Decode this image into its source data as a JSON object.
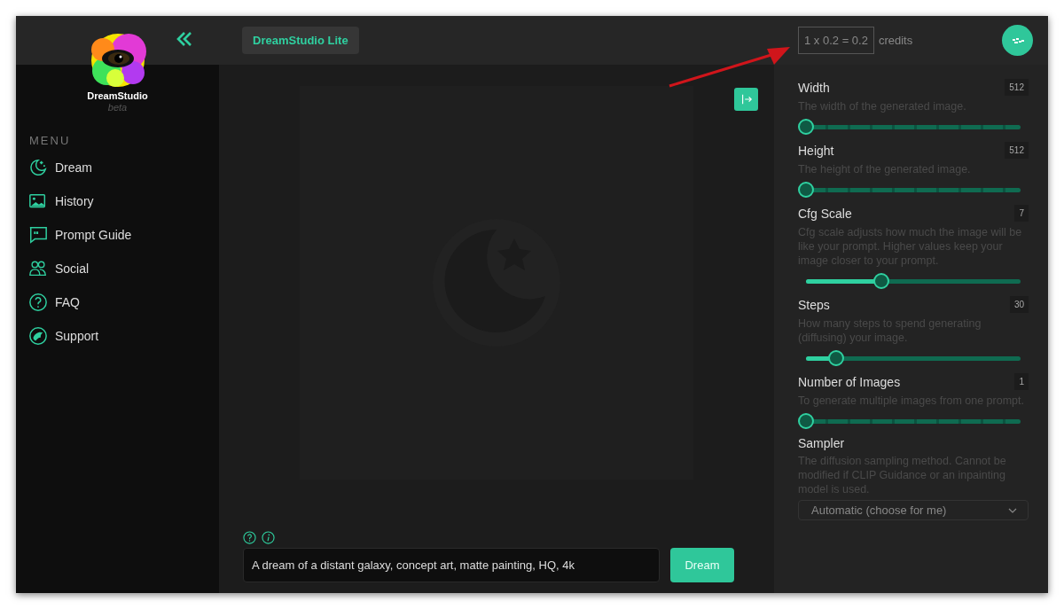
{
  "sidebar": {
    "brand": "DreamStudio",
    "brand_tag": "beta",
    "menu_heading": "MENU",
    "items": [
      {
        "label": "Dream"
      },
      {
        "label": "History"
      },
      {
        "label": "Prompt Guide"
      },
      {
        "label": "Social"
      },
      {
        "label": "FAQ"
      },
      {
        "label": "Support"
      }
    ]
  },
  "header": {
    "product": "DreamStudio Lite"
  },
  "credits": {
    "formula": "1 x 0.2 = 0.2",
    "unit": "credits"
  },
  "settings": [
    {
      "kind": "stepped",
      "label": "Width",
      "value": "512",
      "description": "The width of the generated image.",
      "level": 0
    },
    {
      "kind": "stepped",
      "label": "Height",
      "value": "512",
      "description": "The height of the generated image.",
      "level": 0
    },
    {
      "kind": "fine",
      "label": "Cfg Scale",
      "value": "7",
      "description": "Cfg scale adjusts how much the image will be like your prompt. Higher values keep your image closer to your prompt.",
      "level": 0.35
    },
    {
      "kind": "smooth",
      "label": "Steps",
      "value": "30",
      "description": "How many steps to spend generating (diffusing) your image.",
      "level": 0.14
    },
    {
      "kind": "stepped",
      "label": "Number of Images",
      "value": "1",
      "description": "To generate multiple images from one prompt.",
      "level": 0
    },
    {
      "kind": "select",
      "label": "Sampler",
      "description": "The diffusion sampling method. Cannot be modified if CLIP Guidance or an inpainting model is used.",
      "value": "Automatic (choose for me)"
    }
  ],
  "prompt": {
    "value": "A dream of a distant galaxy, concept art, matte painting, HQ, 4k",
    "button": "Dream"
  }
}
